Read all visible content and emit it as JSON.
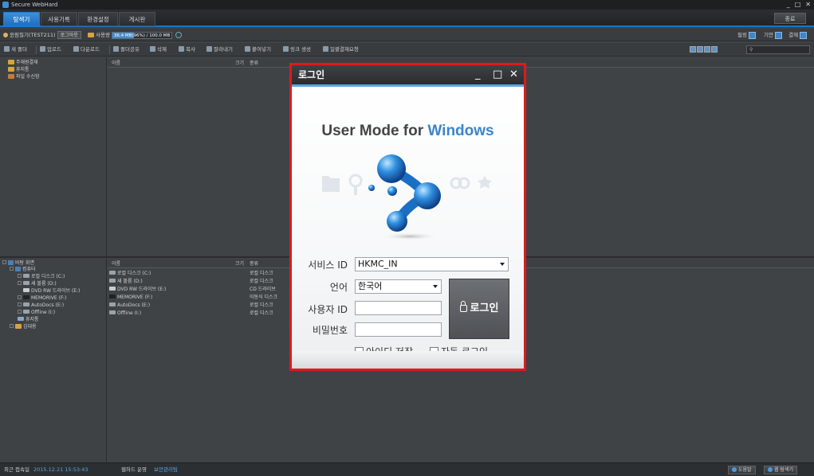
{
  "window": {
    "title": "Secure WebHard",
    "minimize": "_",
    "maximize": "□",
    "close": "✕"
  },
  "menu": {
    "tabs": [
      "탐색기",
      "사용기록",
      "환경설정",
      "게시판"
    ],
    "right_button": "종료"
  },
  "userbar": {
    "user": "윈림질기(TEST211)",
    "logout": "로그아웃",
    "usage_label": "사용량",
    "usage_value": "36.4 MB(96%) / 100.0 MB",
    "usage_fraction": 0.36,
    "right": [
      "필링",
      "기안",
      "결재"
    ]
  },
  "toolbar": {
    "items": [
      "새 폴더",
      "업로드",
      "다운로드",
      "폴더공유",
      "삭제",
      "복사",
      "잘라내기",
      "붙여넣기",
      "링크 생성",
      "일괄결재요청"
    ]
  },
  "search": {
    "placeholder": ""
  },
  "tree_top": [
    "주재원결재",
    "휴지통",
    "파일 수신함"
  ],
  "list_top": {
    "columns": [
      "이름",
      "크기",
      "종류"
    ]
  },
  "tree_bottom": [
    "바탕 화면",
    "컴퓨터",
    "로컬 디스크 (C:)",
    "새 볼륨 (D:)",
    "DVD RW 드라이브 (E:)",
    "MEMORIVE (F:)",
    "AutoDocs (E:)",
    "Offline (I:)",
    "휴지통",
    "김대용"
  ],
  "list_bottom": {
    "columns": [
      "이름",
      "크기",
      "종류"
    ],
    "rows": [
      {
        "name": "로컬 디스크 (C:)",
        "type": "로컬 디스크"
      },
      {
        "name": "새 볼륨 (D:)",
        "type": "로컬 디스크"
      },
      {
        "name": "DVD RW 드라이브 (E:)",
        "type": "CD 드라이브"
      },
      {
        "name": "MEMORIVE (F:)",
        "type": "이동식 디스크"
      },
      {
        "name": "AutoDocs (E:)",
        "type": "로컬 디스크"
      },
      {
        "name": "Offline (I:)",
        "type": "로컬 디스크"
      }
    ]
  },
  "status": {
    "last_login_label": "최근 접속일",
    "last_login_value": "2015.12.21 15:53:43",
    "webhard_label": "웹하드 운영",
    "webhard_value": "보안관리팀",
    "help": "도움말",
    "web_explorer": "웹 탐색기"
  },
  "dialog": {
    "title": "로그인",
    "brand_prefix": "User Mode for ",
    "brand_suffix": "Windows",
    "service_label": "서비스 ID",
    "service_value": "HKMC_IN",
    "language_label": "언어",
    "language_value": "한국어",
    "user_label": "사용자 ID",
    "user_value": "",
    "password_label": "비밀번호",
    "password_value": "",
    "login_button": "로그인",
    "save_id": "아이디 저장",
    "auto_login": "자동 로그인"
  },
  "colors": {
    "accent": "#1a73c9",
    "highlight_border": "#e01919",
    "brand_blue": "#3d84c6"
  }
}
